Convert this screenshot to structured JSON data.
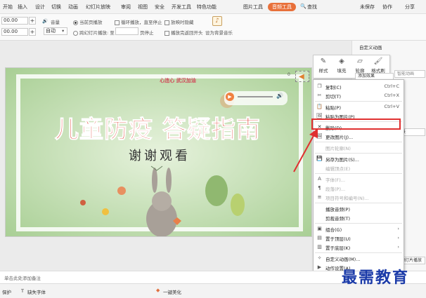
{
  "menubar": {
    "items": [
      "开始",
      "插入",
      "设计",
      "切换",
      "动画",
      "幻灯片放映",
      "审阅",
      "视图",
      "安全",
      "开发工具",
      "特色功能",
      "图片工具"
    ],
    "active": "音频工具",
    "search": "查找",
    "right": [
      "未保存",
      "协作",
      "分享"
    ]
  },
  "toolbar": {
    "val1": "00.00",
    "val2": "00.00",
    "play_opt": "当前页播放",
    "auto": "自动",
    "cross_opt": "跨幻灯片播放: 至",
    "loop": "循环播放，直至停止",
    "hide": "放映时隐藏",
    "page_stop": "页停止",
    "rewind": "播放完返回开头",
    "bg_music": "设为背景音乐"
  },
  "slide": {
    "title": "儿童防疫 答疑指南",
    "subtitle": "谢谢观看",
    "badge": "心连心 武汉加油"
  },
  "floatbar": {
    "items": [
      "样式",
      "填充",
      "轮廓",
      "格式刷"
    ],
    "add_effect": "添加效果",
    "smart": "智能动画",
    "num": "0"
  },
  "context_menu": [
    {
      "icon": "copy-icon",
      "glyph": "❐",
      "label": "复制(C)",
      "sc": "Ctrl+C"
    },
    {
      "icon": "cut-icon",
      "glyph": "✂",
      "label": "剪切(T)",
      "sc": "Ctrl+X"
    },
    {
      "icon": "paste-icon",
      "glyph": "📋",
      "label": "粘贴(P)",
      "sc": "Ctrl+V"
    },
    {
      "icon": "paste-image-icon",
      "glyph": "🖼",
      "label": "粘贴为图片(P)",
      "sc": ""
    },
    {
      "icon": "delete-icon",
      "glyph": "✕",
      "label": "删除(D)",
      "sc": "",
      "highlight": true
    },
    {
      "icon": "change-image-icon",
      "glyph": "🖼",
      "label": "更改图片(J)...",
      "sc": ""
    },
    {
      "icon": "",
      "glyph": "",
      "label": "图片轮廓(N)",
      "sc": "",
      "dis": true
    },
    {
      "icon": "save-as-image-icon",
      "glyph": "💾",
      "label": "另存为图片(S)...",
      "sc": ""
    },
    {
      "icon": "",
      "glyph": "",
      "label": "编辑顶点(E)",
      "sc": "",
      "dis": true
    },
    {
      "icon": "font-icon",
      "glyph": "A",
      "label": "字体(F)...",
      "sc": "",
      "dis": true
    },
    {
      "icon": "paragraph-icon",
      "glyph": "¶",
      "label": "段落(P)...",
      "sc": "",
      "dis": true
    },
    {
      "icon": "numbering-icon",
      "glyph": "≡",
      "label": "项目符号和编号(N)...",
      "sc": "",
      "dis": true
    },
    {
      "icon": "",
      "glyph": "",
      "label": "播放音频(P)",
      "sc": ""
    },
    {
      "icon": "",
      "glyph": "",
      "label": "剪裁音频(T)",
      "sc": ""
    },
    {
      "icon": "group-icon",
      "glyph": "▣",
      "label": "组合(G)",
      "sc": "›"
    },
    {
      "icon": "bring-front-icon",
      "glyph": "▤",
      "label": "置于顶层(U)",
      "sc": "›"
    },
    {
      "icon": "send-back-icon",
      "glyph": "▥",
      "label": "置于底层(K)",
      "sc": "›"
    },
    {
      "icon": "custom-anim-icon",
      "glyph": "✧",
      "label": "自定义动画(M)...",
      "sc": ""
    },
    {
      "icon": "action-icon",
      "glyph": "▶",
      "label": "动作设置(A)...",
      "sc": ""
    },
    {
      "icon": "settings-icon",
      "glyph": "⚙",
      "label": "设置对...",
      "sc": ""
    },
    {
      "icon": "hyperlink-icon",
      "glyph": "🔗",
      "label": "超链接(H)...",
      "sc": ""
    }
  ],
  "rightpanel": {
    "custom_anim": "自定义动画",
    "label1": "添加效果",
    "label2": "背景",
    "label3": "幻灯片播放"
  },
  "notes": {
    "text": "单击此处添加备注"
  },
  "statusbar": {
    "protect": "保护",
    "missing_font": "缺失字体",
    "beautify": "一键美化"
  },
  "watermark": "最需教育"
}
